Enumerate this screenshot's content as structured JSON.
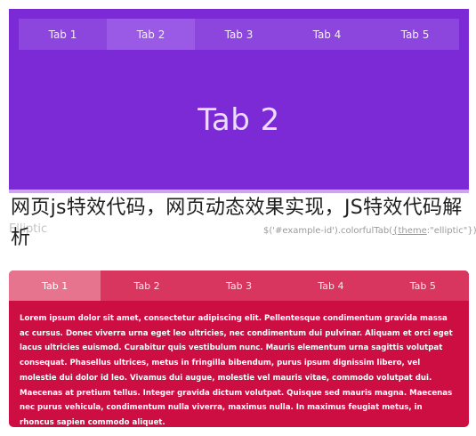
{
  "top_demo": {
    "tabs": [
      {
        "label": "Tab 1",
        "active": false
      },
      {
        "label": "Tab 2",
        "active": true
      },
      {
        "label": "Tab 3",
        "active": false
      },
      {
        "label": "Tab 4",
        "active": false
      },
      {
        "label": "Tab 5",
        "active": false
      }
    ],
    "content_heading": "Tab 2",
    "colors": {
      "background": "#7b2ad6",
      "tab_bar": "#8c46dd",
      "active_tab": "#9a5ae6"
    }
  },
  "middle": {
    "ghost_label": "Elliptic",
    "code_prefix": "$('#example-id').colorfulTab(",
    "code_theme": "{theme",
    "code_suffix": ":\"elliptic\"});",
    "overlay_title": "网页js特效代码，网页动态效果实现，JS特效代码解析"
  },
  "bottom_demo": {
    "tabs": [
      {
        "label": "Tab 1",
        "active": true
      },
      {
        "label": "Tab 2",
        "active": false
      },
      {
        "label": "Tab 3",
        "active": false
      },
      {
        "label": "Tab 4",
        "active": false
      },
      {
        "label": "Tab 5",
        "active": false
      }
    ],
    "paragraph": "Lorem ipsum dolor sit amet, consectetur adipiscing elit. Pellentesque condimentum gravida massa ac cursus. Donec viverra urna eget leo ultricies, nec condimentum dui pulvinar. Aliquam et orci eget lacus ultricies euismod. Curabitur quis vestibulum nunc. Mauris elementum urna sagittis volutpat consequat. Phasellus ultrices, metus in fringilla bibendum, purus ipsum dignissim libero, vel molestie dui dolor id leo. Vivamus dui augue, molestie vel mauris vitae, commodo volutpat dui. Maecenas at pretium tellus. Integer gravida dictum volutpat. Quisque sed mauris magna. Maecenas nec purus vehicula, condimentum nulla viverra, maximus nulla. In maximus feugiat metus, in rhoncus sapien commodo aliquet.",
    "colors": {
      "background": "#cc0e43",
      "tab_bar": "#d8365f",
      "active_tab": "#e6748f"
    }
  }
}
